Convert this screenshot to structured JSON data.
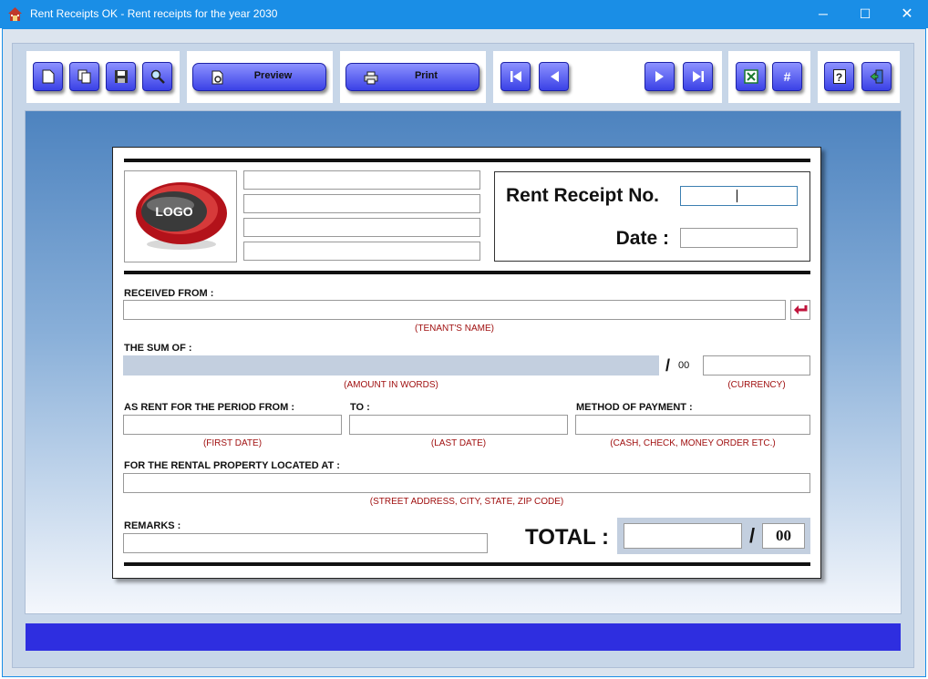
{
  "window": {
    "title": "Rent Receipts OK - Rent receipts for the year 2030",
    "controls": {
      "minimize": "─",
      "maximize": "☐",
      "close": "✕"
    }
  },
  "toolbar": {
    "preview_label": "Preview",
    "print_label": "Print",
    "button_glyphs": {
      "hash": "#",
      "help": "?"
    },
    "icons": [
      "new-document-icon",
      "copy-icon",
      "save-icon",
      "search-icon",
      "preview-icon",
      "printer-icon",
      "first-record-icon",
      "previous-record-icon",
      "next-record-icon",
      "last-record-icon",
      "excel-icon",
      "number-icon",
      "help-icon",
      "exit-icon"
    ]
  },
  "receipt": {
    "logo_text": "LOGO",
    "receipt_no_label": "Rent Receipt No.",
    "date_label": "Date :",
    "received_from_label": "RECEIVED FROM :",
    "tenant_hint": "(TENANT'S NAME)",
    "sum_label": "THE SUM OF :",
    "sum_slash": "/",
    "sum_cents": "00",
    "amount_words_hint": "(AMOUNT IN WORDS)",
    "currency_hint": "(CURRENCY)",
    "period_from_label": "AS RENT FOR THE PERIOD FROM :",
    "to_label": "TO :",
    "method_label": "METHOD OF PAYMENT :",
    "first_date_hint": "(FIRST DATE)",
    "last_date_hint": "(LAST DATE)",
    "method_hint": "(CASH, CHECK, MONEY ORDER ETC.)",
    "property_label": "FOR THE RENTAL PROPERTY LOCATED AT :",
    "address_hint": "(STREET ADDRESS, CITY, STATE, ZIP CODE)",
    "remarks_label": "REMARKS :",
    "total_label": "TOTAL :",
    "total_slash": "/",
    "total_cents": "00"
  },
  "colors": {
    "titlebar": "#1a8ee6",
    "button": "#3a41e6",
    "status_bar": "#2e2ee0",
    "hint_text": "#a01010",
    "grey_field": "#c3cfdf"
  }
}
